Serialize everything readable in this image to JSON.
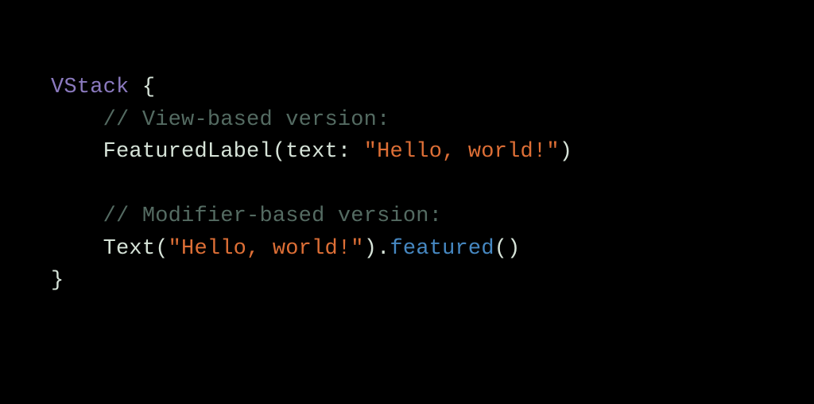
{
  "code": {
    "line1": {
      "type": "VStack",
      "brace_open": " {"
    },
    "line2": {
      "indent": "    ",
      "comment": "// View-based version:"
    },
    "line3": {
      "indent": "    ",
      "call": "FeaturedLabel",
      "paren_open": "(",
      "label": "text: ",
      "string": "\"Hello, world!\"",
      "paren_close": ")"
    },
    "line4": {
      "indent": "    ",
      "comment": "// Modifier-based version:"
    },
    "line5": {
      "indent": "    ",
      "call": "Text",
      "paren_open": "(",
      "string": "\"Hello, world!\"",
      "paren_close": ")",
      "dot": ".",
      "method": "featured",
      "paren_open2": "(",
      "paren_close2": ")"
    },
    "line6": {
      "brace_close": "}"
    }
  }
}
